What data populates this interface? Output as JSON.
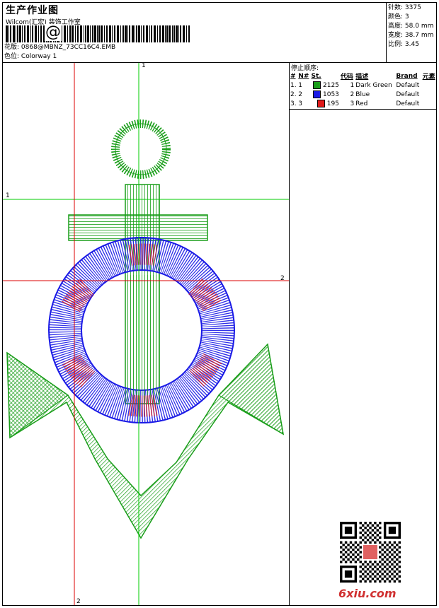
{
  "header": {
    "title": "生产作业图",
    "company": "Wilcom(汇宏) 装饰工作室",
    "barcode_symbol": "@",
    "design_file_label": "花版:",
    "design_file": "0868@MBNZ_73CC16C4.EMB",
    "colorway_label": "色位:",
    "colorway": "Colorway 1"
  },
  "stats": [
    {
      "label": "针数:",
      "value": "3375"
    },
    {
      "label": "颜色:",
      "value": "3"
    },
    {
      "label": "高度:",
      "value": "58.0 mm"
    },
    {
      "label": "宽度:",
      "value": "38.7 mm"
    },
    {
      "label": "比例:",
      "value": "3.45"
    }
  ],
  "stop_sequence": {
    "title": "停止顺序:",
    "columns": [
      "#",
      "N#",
      "St.",
      "代码",
      "描述",
      "Brand",
      "元素"
    ],
    "rows": [
      {
        "num": "1.",
        "n": "1",
        "color": "#1a9e1a",
        "stitches": "2125",
        "code": "1",
        "desc": "Dark Green",
        "brand": "Default"
      },
      {
        "num": "2.",
        "n": "2",
        "color": "#1a1ae6",
        "stitches": "1053",
        "code": "2",
        "desc": "Blue",
        "brand": "Default"
      },
      {
        "num": "3.",
        "n": "3",
        "color": "#e01a1a",
        "stitches": "195",
        "code": "3",
        "desc": "Red",
        "brand": "Default"
      }
    ]
  },
  "guides": {
    "green_v_label": "1",
    "green_h_label": "1",
    "red_h_label": "2",
    "red_v_label": "2"
  },
  "watermark": "6xiu.com",
  "colors": {
    "green": "#1a9e1a",
    "blue": "#1a1ae6",
    "red": "#e01a1a",
    "guide_green": "#00cc00",
    "guide_red": "#dd0000"
  }
}
